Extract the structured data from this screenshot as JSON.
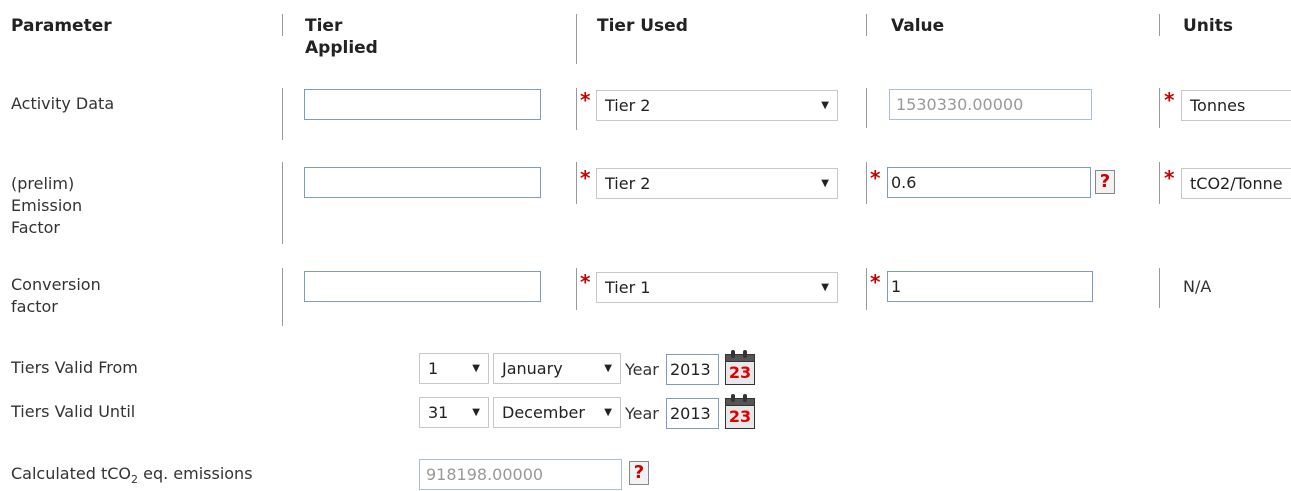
{
  "headers": {
    "parameter": "Parameter",
    "tier_applied": "Tier Applied",
    "tier_used": "Tier Used",
    "value": "Value",
    "units": "Units"
  },
  "rows": [
    {
      "label": "Activity Data",
      "tier_applied": "",
      "tier_used": "Tier 2",
      "value": "1530330.00000",
      "units": "Tonnes"
    },
    {
      "label": "(prelim) Emission Factor",
      "tier_applied": "",
      "tier_used": "Tier 2",
      "value": "0.6",
      "units": "tCO2/Tonne"
    },
    {
      "label": "Conversion factor",
      "tier_applied": "",
      "tier_used": "Tier 1",
      "value": "1",
      "units": "N/A"
    }
  ],
  "valid_from": {
    "label": "Tiers Valid From",
    "day": "1",
    "month": "January",
    "year_label": "Year",
    "year": "2013",
    "calendar_day": "23"
  },
  "valid_until": {
    "label": "Tiers Valid Until",
    "day": "31",
    "month": "December",
    "year_label": "Year",
    "year": "2013",
    "calendar_day": "23"
  },
  "calculated": {
    "label_prefix": "Calculated tCO",
    "label_sub": "2",
    "label_suffix": " eq. emissions",
    "value": "918198.00000"
  },
  "icons": {
    "required": "*",
    "help": "?",
    "dropdown": "▼"
  },
  "colors": {
    "required": "#cc0000",
    "field_border": "#7f9db9"
  }
}
